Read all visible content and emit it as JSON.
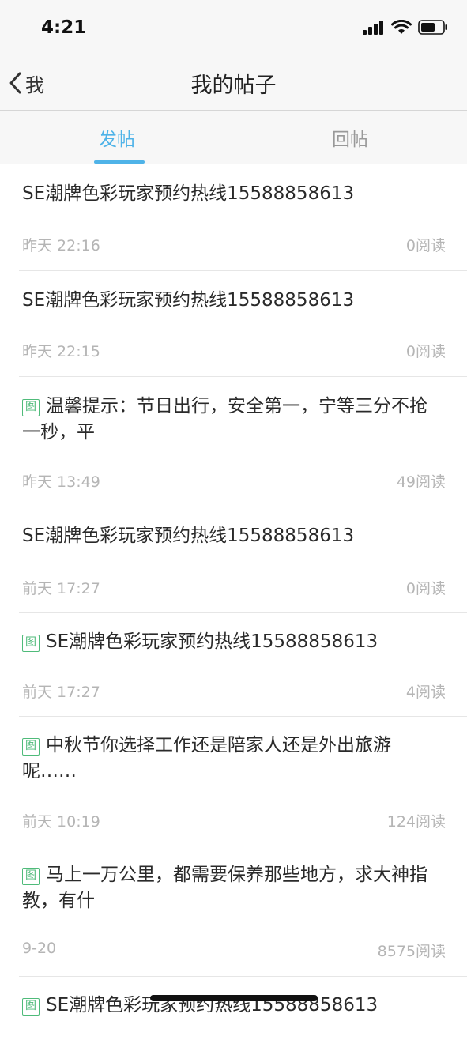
{
  "status_bar": {
    "time": "4:21"
  },
  "nav": {
    "back_label": "我",
    "title": "我的帖子"
  },
  "tabs": [
    {
      "label": "发帖",
      "active": true
    },
    {
      "label": "回帖",
      "active": false
    }
  ],
  "badge_label": "图",
  "posts": [
    {
      "title": "SE潮牌色彩玩家预约热线15588858613",
      "has_image": false,
      "time": "昨天 22:16",
      "reads": "0阅读"
    },
    {
      "title": "SE潮牌色彩玩家预约热线15588858613",
      "has_image": false,
      "time": "昨天 22:15",
      "reads": "0阅读"
    },
    {
      "title": "温馨提示：节日出行，安全第一，宁等三分不抢一秒，平",
      "has_image": true,
      "time": "昨天 13:49",
      "reads": "49阅读"
    },
    {
      "title": "SE潮牌色彩玩家预约热线15588858613",
      "has_image": false,
      "time": "前天 17:27",
      "reads": "0阅读"
    },
    {
      "title": "SE潮牌色彩玩家预约热线15588858613",
      "has_image": true,
      "time": "前天 17:27",
      "reads": "4阅读"
    },
    {
      "title": "中秋节你选择工作还是陪家人还是外出旅游呢……",
      "has_image": true,
      "time": "前天 10:19",
      "reads": "124阅读"
    },
    {
      "title": "马上一万公里，都需要保养那些地方，求大神指教，有什",
      "has_image": true,
      "time": "9-20",
      "reads": "8575阅读"
    },
    {
      "title": "SE潮牌色彩玩家预约热线15588858613",
      "has_image": true,
      "time": "",
      "reads": ""
    }
  ],
  "colors": {
    "accent": "#4fb3e8",
    "badge": "#4fbb7a",
    "meta_text": "#b5b5b5"
  },
  "icons": [
    "signal-icon",
    "wifi-icon",
    "battery-icon",
    "back-chevron-icon",
    "image-badge-icon"
  ]
}
